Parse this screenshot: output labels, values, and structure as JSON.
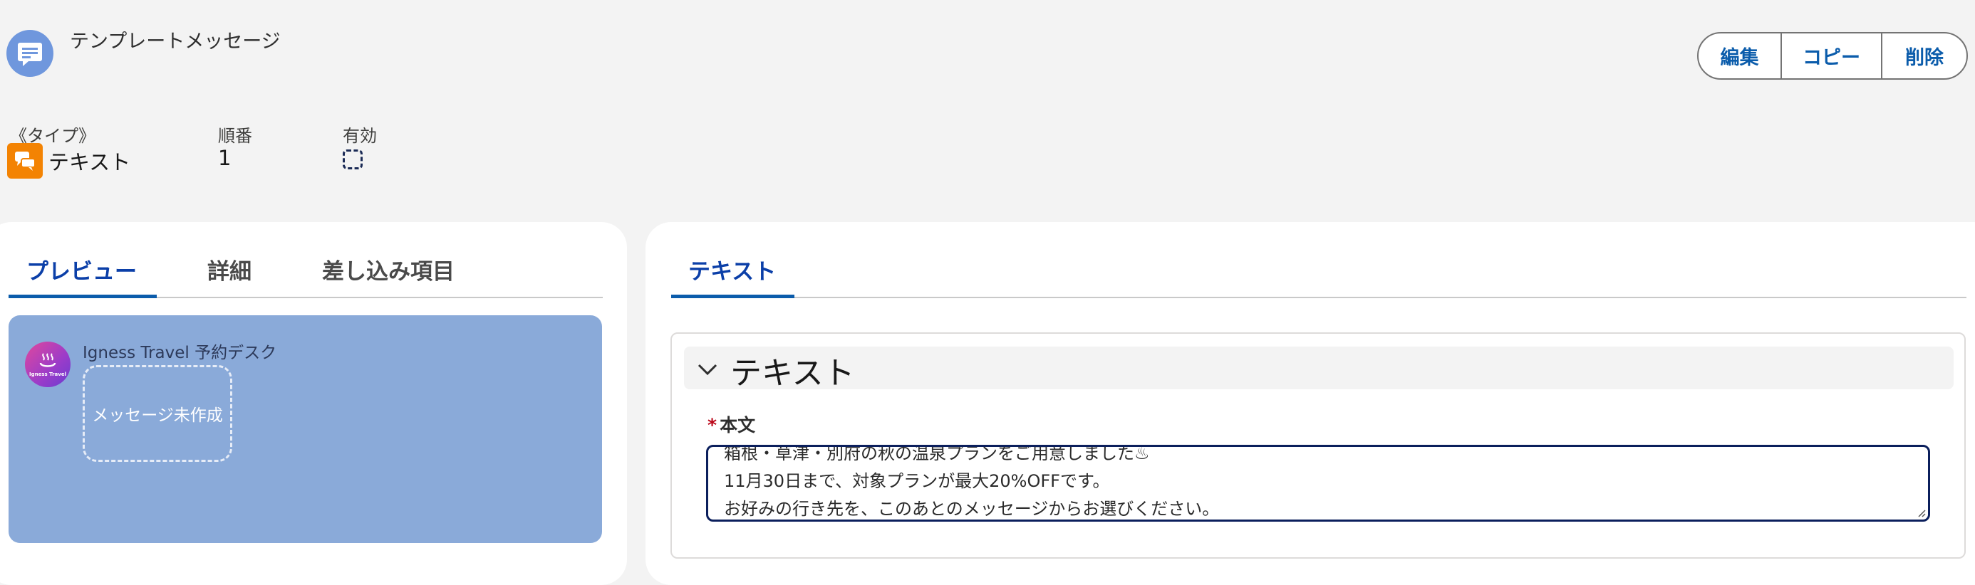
{
  "header": {
    "title": "テンプレートメッセージ",
    "icon": "template-message-icon"
  },
  "actions": {
    "edit": "編集",
    "copy": "コピー",
    "delete": "削除"
  },
  "highlights": {
    "type_label": "《タイプ》",
    "type_value": "テキスト",
    "type_icon": "chat-bubbles-icon",
    "order_label": "順番",
    "order_value": "1",
    "active_label": "有効",
    "active_checked": false
  },
  "left_tabs": [
    {
      "label": "プレビュー",
      "active": true
    },
    {
      "label": "詳細",
      "active": false
    },
    {
      "label": "差し込み項目",
      "active": false
    }
  ],
  "preview": {
    "sender_name": "Igness Travel 予約デスク",
    "avatar_text": "Igness Travel",
    "bubble_text": "メッセージ未作成"
  },
  "right_tabs": [
    {
      "label": "テキスト",
      "active": true
    }
  ],
  "section": {
    "title": "テキスト",
    "field_label": "本文",
    "required_mark": "*",
    "body_lines": [
      "箱根・草津・別府の秋の温泉プランをご用意しました♨",
      "11月30日まで、対象プランが最大20%OFFです。",
      "お好みの行き先を、このあとのメッセージからお選びください。"
    ]
  },
  "colors": {
    "brand_blue": "#0b5cab",
    "type_orange": "#f38303",
    "preview_bg": "#8aaad9",
    "header_icon_bg": "#6f97dd",
    "required_red": "#ba0517"
  }
}
